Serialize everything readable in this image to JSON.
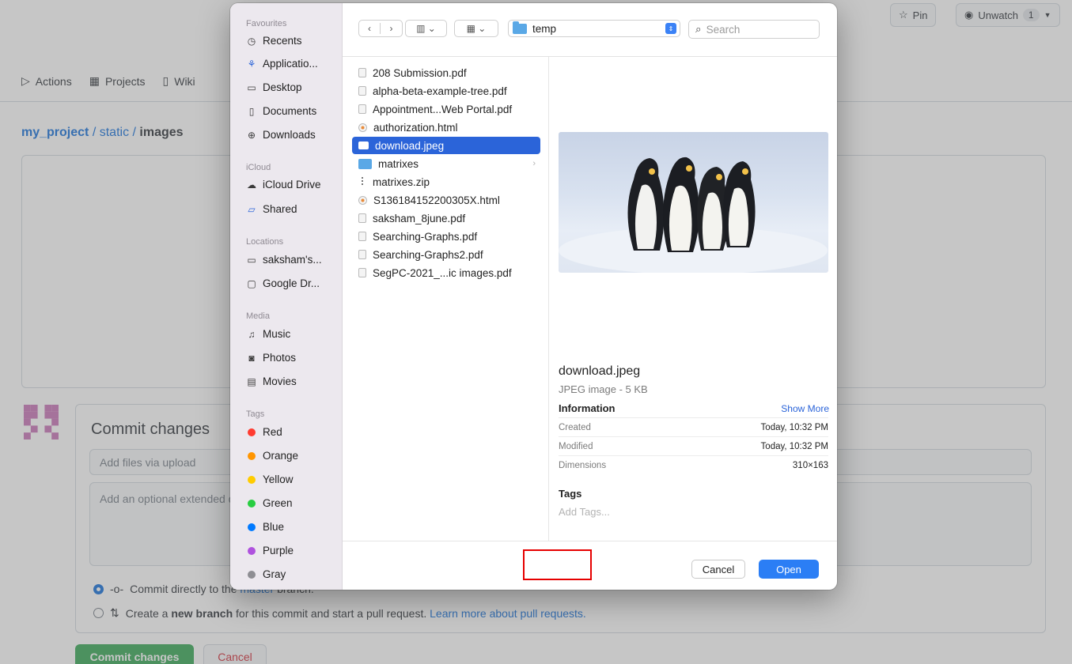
{
  "github": {
    "pin_label": "Pin",
    "unwatch_label": "Unwatch",
    "unwatch_count": "1",
    "nav": [
      "Actions",
      "Projects",
      "Wiki"
    ],
    "breadcrumb": {
      "repo": "my_project",
      "sep1": " / ",
      "dir": "static",
      "sep2": " / ",
      "current": "images"
    },
    "commit": {
      "title": "Commit changes",
      "summary_placeholder": "Add files via upload",
      "description_placeholder": "Add an optional extended description…",
      "option_direct_prefix": "Commit directly to the ",
      "option_direct_branch": "master",
      "option_direct_suffix": " branch.",
      "option_branch_prefix": "Create a ",
      "option_branch_bold": "new branch",
      "option_branch_rest": " for this commit and start a pull request. ",
      "option_branch_link": "Learn more about pull requests.",
      "commit_button": "Commit changes",
      "cancel_button": "Cancel"
    }
  },
  "dialog": {
    "sidebar": {
      "favourites_heading": "Favourites",
      "favourites": [
        "Recents",
        "Applicatio...",
        "Desktop",
        "Documents",
        "Downloads"
      ],
      "icloud_heading": "iCloud",
      "icloud": [
        "iCloud Drive",
        "Shared"
      ],
      "locations_heading": "Locations",
      "locations": [
        "saksham's...",
        "Google Dr..."
      ],
      "media_heading": "Media",
      "media": [
        "Music",
        "Photos",
        "Movies"
      ],
      "tags_heading": "Tags",
      "tags": [
        {
          "name": "Red",
          "color": "#ff3b30"
        },
        {
          "name": "Orange",
          "color": "#ff9500"
        },
        {
          "name": "Yellow",
          "color": "#ffcc00"
        },
        {
          "name": "Green",
          "color": "#28cd41"
        },
        {
          "name": "Blue",
          "color": "#007aff"
        },
        {
          "name": "Purple",
          "color": "#af52de"
        },
        {
          "name": "Gray",
          "color": "#8e8e93"
        }
      ]
    },
    "toolbar": {
      "back_icon": "chevron-left-icon",
      "forward_icon": "chevron-right-icon",
      "view_icon": "columns-view-icon",
      "group_icon": "grid-group-icon",
      "path_folder": "temp",
      "search_placeholder": "Search"
    },
    "files": [
      {
        "name": "208 Submission.pdf",
        "kind": "pdf"
      },
      {
        "name": "alpha-beta-example-tree.pdf",
        "kind": "pdf"
      },
      {
        "name": "Appointment...Web Portal.pdf",
        "kind": "pdf"
      },
      {
        "name": "authorization.html",
        "kind": "html"
      },
      {
        "name": "download.jpeg",
        "kind": "img",
        "selected": true
      },
      {
        "name": "matrixes",
        "kind": "folder"
      },
      {
        "name": "matrixes.zip",
        "kind": "zip"
      },
      {
        "name": "S136184152200305X.html",
        "kind": "html"
      },
      {
        "name": "saksham_8june.pdf",
        "kind": "pdf"
      },
      {
        "name": "Searching-Graphs.pdf",
        "kind": "pdf"
      },
      {
        "name": "Searching-Graphs2.pdf",
        "kind": "pdf"
      },
      {
        "name": "SegPC-2021_...ic images.pdf",
        "kind": "pdf"
      }
    ],
    "preview": {
      "name": "download.jpeg",
      "kind": "JPEG image - 5 KB",
      "info_heading": "Information",
      "show_more": "Show More",
      "rows": [
        {
          "key": "Created",
          "value": "Today, 10:32 PM"
        },
        {
          "key": "Modified",
          "value": "Today, 10:32 PM"
        },
        {
          "key": "Dimensions",
          "value": "310×163"
        }
      ],
      "tags_heading": "Tags",
      "tags_placeholder": "Add Tags..."
    },
    "buttons": {
      "cancel": "Cancel",
      "open": "Open"
    },
    "accent_color": "#2b64d9"
  }
}
